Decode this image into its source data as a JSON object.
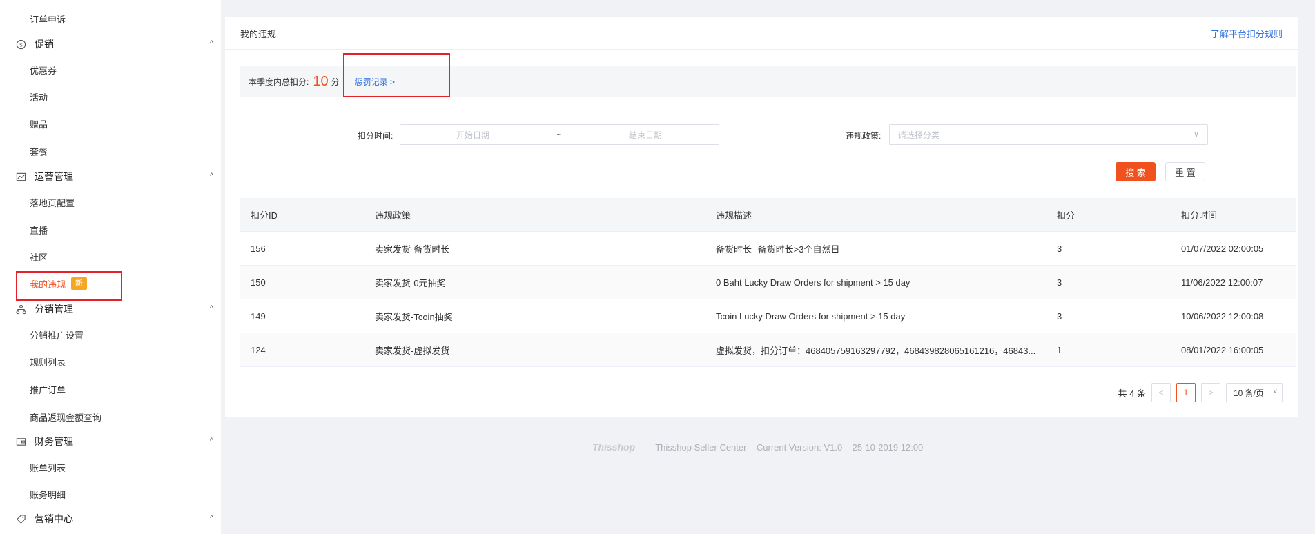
{
  "sidebar": {
    "top_item": "订单申诉",
    "promo": {
      "label": "促销",
      "icon": "promo-icon",
      "items": [
        "优惠券",
        "活动",
        "赠品",
        "套餐"
      ]
    },
    "ops": {
      "label": "运营管理",
      "icon": "chart-icon",
      "items": [
        "落地页配置",
        "直播",
        "社区",
        "我的违规"
      ],
      "badge": "新"
    },
    "dist": {
      "label": "分销管理",
      "icon": "network-icon",
      "items": [
        "分销推广设置",
        "规则列表",
        "推广订单",
        "商品返现金额查询"
      ]
    },
    "finance": {
      "label": "财务管理",
      "icon": "wallet-icon",
      "items": [
        "账单列表",
        "账务明细"
      ]
    },
    "market": {
      "label": "营销中心",
      "icon": "tag-icon"
    }
  },
  "header": {
    "title": "我的违规",
    "rule_link": "了解平台扣分规则"
  },
  "summary": {
    "label": "本季度内总扣分:",
    "points": "10",
    "unit": "分",
    "record_link": "惩罚记录 >"
  },
  "filters": {
    "time_label": "扣分时间:",
    "start_placeholder": "开始日期",
    "sep": "~",
    "end_placeholder": "结束日期",
    "policy_label": "违规政策:",
    "policy_placeholder": "请选择分类"
  },
  "buttons": {
    "search": "搜 索",
    "reset": "重 置"
  },
  "table": {
    "headers": [
      "扣分ID",
      "违规政策",
      "违规描述",
      "扣分",
      "扣分时间"
    ],
    "rows": [
      [
        "156",
        "卖家发货-备货时长",
        "备货时长--备货时长>3个自然日",
        "3",
        "01/07/2022 02:00:05"
      ],
      [
        "150",
        "卖家发货-0元抽奖",
        "0 Baht Lucky Draw Orders for shipment > 15 day",
        "3",
        "11/06/2022 12:00:07"
      ],
      [
        "149",
        "卖家发货-Tcoin抽奖",
        "Tcoin Lucky Draw Orders for shipment > 15 day",
        "3",
        "10/06/2022 12:00:08"
      ],
      [
        "124",
        "卖家发货-虚拟发货",
        "虚拟发货，扣分订单：468405759163297792，468439828065161216，46843...",
        "1",
        "08/01/2022 16:00:05"
      ]
    ]
  },
  "pager": {
    "total": "共 4 条",
    "prev": "<",
    "page": "1",
    "next": ">",
    "size": "10 条/页"
  },
  "footer": {
    "logo": "Thisshop",
    "text": "Thisshop Seller Center    Current Version: V1.0    25-10-2019 12:00"
  },
  "colors": {
    "accent": "#f0511d",
    "link": "#2d6fe0",
    "highlight": "#e8202b"
  }
}
